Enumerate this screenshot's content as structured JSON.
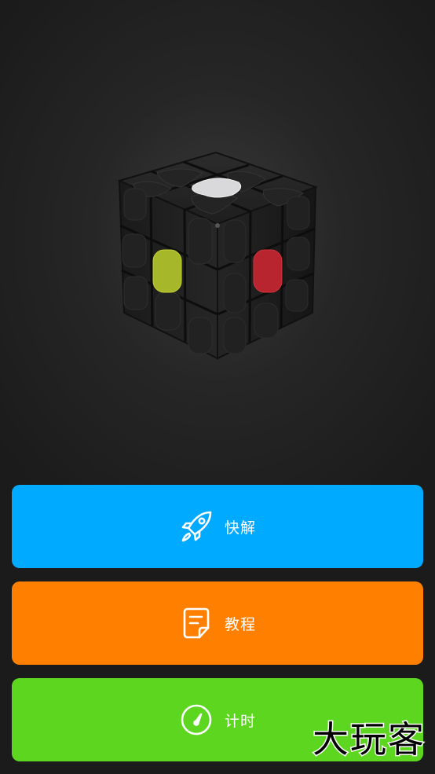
{
  "cube": {
    "icon": "rubiks-cube-3d",
    "sticker_colors": {
      "top_center": "#d7d7d9",
      "left_center": "#a4b42a",
      "right_center": "#b8252f",
      "body": "#1c1c1c"
    }
  },
  "buttons": [
    {
      "label": "快解",
      "icon": "rocket-icon",
      "color": "#00aaff"
    },
    {
      "label": "教程",
      "icon": "document-icon",
      "color": "#ff7f00"
    },
    {
      "label": "计时",
      "icon": "stopwatch-icon",
      "color": "#5cd61e"
    }
  ],
  "watermark": "大玩客"
}
